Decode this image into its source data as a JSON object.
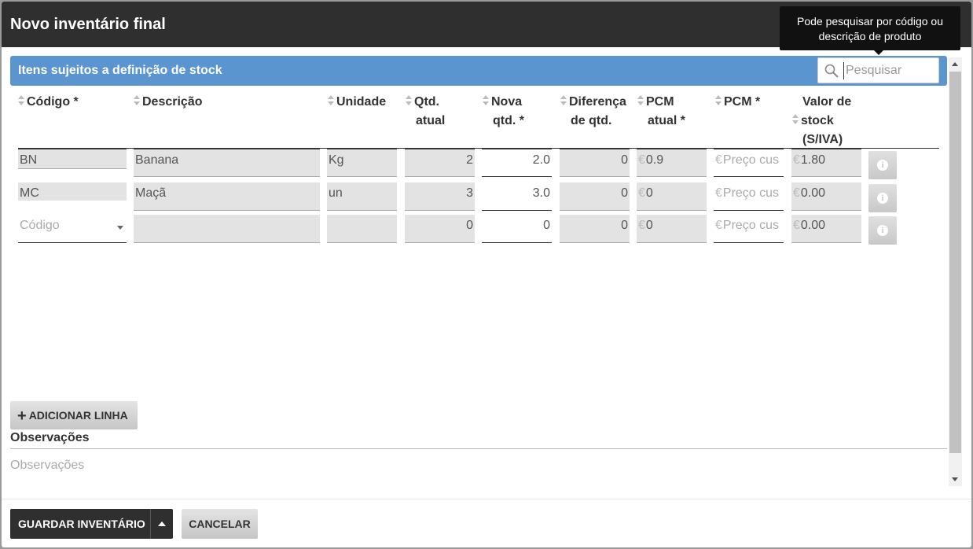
{
  "dialog": {
    "title": "Novo inventário final",
    "tooltip": "Pode pesquisar por código ou descrição de produto"
  },
  "section": {
    "title": "Itens sujeitos a definição de stock",
    "search_placeholder": "Pesquisar"
  },
  "table": {
    "headers": {
      "codigo": "Código *",
      "descricao": "Descrição",
      "unidade": "Unidade",
      "qtd_atual_1": "Qtd.",
      "qtd_atual_2": "atual",
      "nova_qtd_1": "Nova",
      "nova_qtd_2": "qtd. *",
      "diferenca_1": "Diferença",
      "diferenca_2": "de qtd.",
      "pcm_atual_1": "PCM",
      "pcm_atual_2": "atual *",
      "pcm": "PCM *",
      "valor_1": "Valor de",
      "valor_2": "stock",
      "valor_3": "(S/IVA)"
    },
    "currency": "€",
    "rows": [
      {
        "codigo": "BN",
        "descricao": "Banana",
        "unidade": "Kg",
        "qtd_atual": "2",
        "nova_qtd": "2.0",
        "diferenca": "0",
        "pcm_atual": "0.9",
        "pcm": "Preço cus",
        "valor": "1.80"
      },
      {
        "codigo": "MC",
        "descricao": "Maçã",
        "unidade": "un",
        "qtd_atual": "3",
        "nova_qtd": "3.0",
        "diferenca": "0",
        "pcm_atual": "0",
        "pcm": "Preço cus",
        "valor": "0.00"
      },
      {
        "codigo": "Código",
        "descricao": "",
        "unidade": "",
        "qtd_atual": "0",
        "nova_qtd": "0",
        "diferenca": "0",
        "pcm_atual": "0",
        "pcm": "Preço cus",
        "valor": "0.00"
      }
    ]
  },
  "actions": {
    "add_line": "ADICIONAR LINHA",
    "observacoes_label": "Observações",
    "observacoes_placeholder": "Observações",
    "save": "GUARDAR INVENTÁRIO",
    "cancel": "CANCELAR"
  }
}
